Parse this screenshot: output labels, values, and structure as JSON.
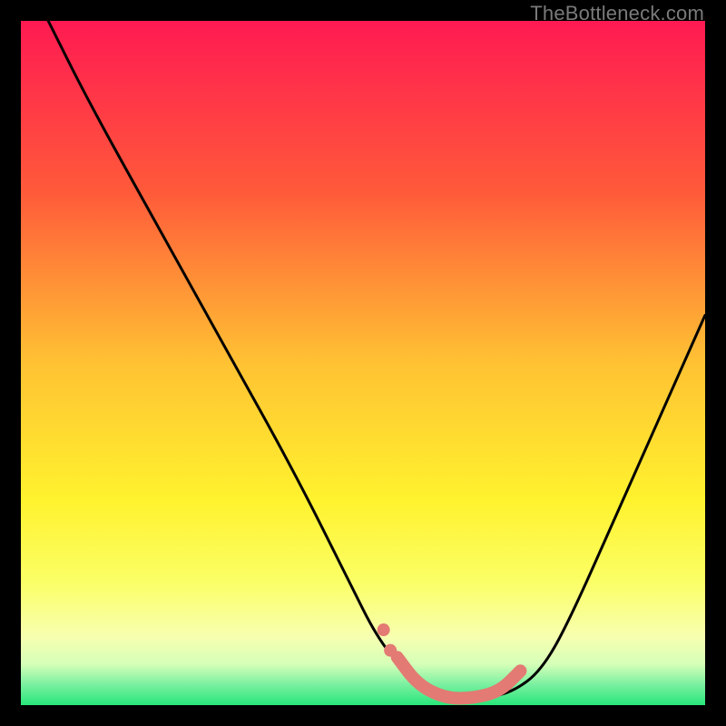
{
  "watermark": "TheBottleneck.com",
  "colors": {
    "bg": "#000000",
    "watermark": "#7a7a7a",
    "curve": "#000000",
    "highlight": "#e37a73",
    "gradient_stops": [
      {
        "offset": 0,
        "color": "#ff1a52"
      },
      {
        "offset": 0.25,
        "color": "#ff5a3a"
      },
      {
        "offset": 0.5,
        "color": "#ffc233"
      },
      {
        "offset": 0.7,
        "color": "#fff22e"
      },
      {
        "offset": 0.82,
        "color": "#fbff66"
      },
      {
        "offset": 0.9,
        "color": "#f7ffb0"
      },
      {
        "offset": 0.94,
        "color": "#d6ffb8"
      },
      {
        "offset": 0.97,
        "color": "#7af0a0"
      },
      {
        "offset": 1.0,
        "color": "#28e67a"
      }
    ]
  },
  "chart_data": {
    "type": "line",
    "title": "",
    "xlabel": "",
    "ylabel": "",
    "xlim": [
      0,
      100
    ],
    "ylim": [
      0,
      100
    ],
    "series": [
      {
        "name": "bottleneck-curve",
        "x": [
          4,
          10,
          20,
          30,
          40,
          48,
          52,
          56,
          60,
          64,
          68,
          72,
          76,
          80,
          88,
          96,
          100
        ],
        "y": [
          100,
          88,
          70,
          52,
          34,
          18,
          10,
          5,
          2,
          1,
          1,
          2,
          5,
          12,
          30,
          48,
          57
        ]
      }
    ],
    "highlight_segment": {
      "name": "optimal-range",
      "x": [
        55,
        58,
        62,
        66,
        70,
        73
      ],
      "y": [
        7,
        3,
        1,
        1,
        2,
        5
      ]
    }
  }
}
